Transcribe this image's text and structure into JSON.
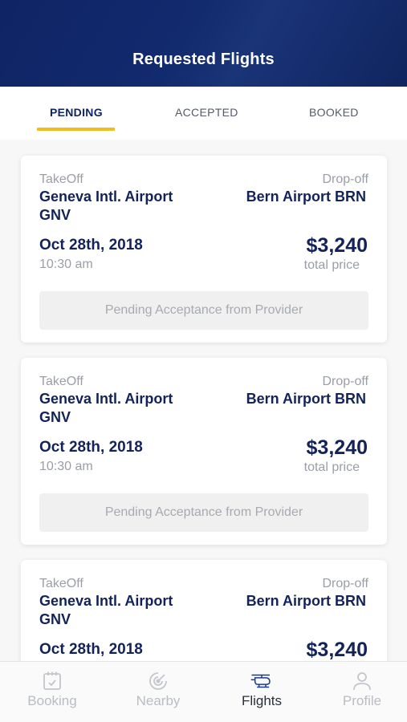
{
  "header": {
    "title": "Requested Flights"
  },
  "tabs": [
    {
      "label": "PENDING"
    },
    {
      "label": "ACCEPTED"
    },
    {
      "label": "BOOKED"
    }
  ],
  "cards": [
    {
      "takeoff_label": "TakeOff",
      "takeoff_airport_line1": "Geneva Intl. Airport",
      "takeoff_airport_line2": "GNV",
      "dropoff_label": "Drop-off",
      "dropoff_airport": "Bern Airport BRN",
      "date": "Oct 28th, 2018",
      "time": "10:30 am",
      "price": "$3,240",
      "price_label": "total price",
      "status": "Pending Acceptance from Provider"
    },
    {
      "takeoff_label": "TakeOff",
      "takeoff_airport_line1": "Geneva Intl. Airport",
      "takeoff_airport_line2": "GNV",
      "dropoff_label": "Drop-off",
      "dropoff_airport": "Bern Airport BRN",
      "date": "Oct 28th, 2018",
      "time": "10:30 am",
      "price": "$3,240",
      "price_label": "total price",
      "status": "Pending Acceptance from Provider"
    },
    {
      "takeoff_label": "TakeOff",
      "takeoff_airport_line1": "Geneva Intl. Airport",
      "takeoff_airport_line2": "GNV",
      "dropoff_label": "Drop-off",
      "dropoff_airport": "Bern Airport BRN",
      "date": "Oct 28th, 2018",
      "price": "$3,240"
    }
  ],
  "bottom_nav": [
    {
      "label": "Booking",
      "icon": "calendar-icon"
    },
    {
      "label": "Nearby",
      "icon": "radar-icon"
    },
    {
      "label": "Flights",
      "icon": "helicopter-icon"
    },
    {
      "label": "Profile",
      "icon": "person-icon"
    }
  ],
  "colors": {
    "header_bg": "#122a6e",
    "accent_underline": "#f2bd1d",
    "text_primary": "#13235a",
    "text_muted": "#9a9ea6"
  }
}
